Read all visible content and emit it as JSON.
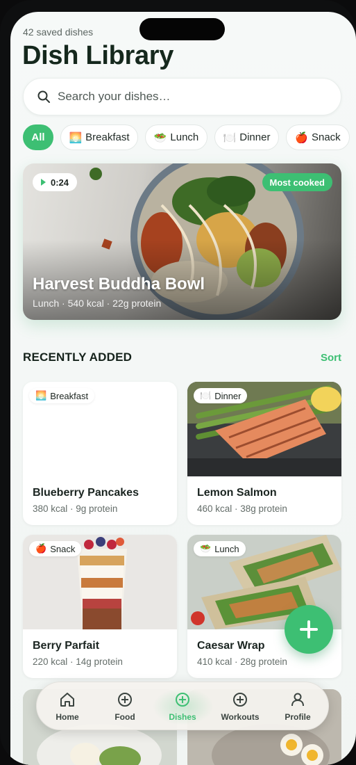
{
  "header": {
    "subtitle": "42 saved dishes",
    "title": "Dish Library"
  },
  "search": {
    "placeholder": "Search your dishes…",
    "icon": "search-icon"
  },
  "filters": [
    {
      "label": "All",
      "emoji": "",
      "active": true
    },
    {
      "label": "Breakfast",
      "emoji": "🌅",
      "active": false
    },
    {
      "label": "Lunch",
      "emoji": "🥗",
      "active": false
    },
    {
      "label": "Dinner",
      "emoji": "🍽️",
      "active": false
    },
    {
      "label": "Snack",
      "emoji": "🍎",
      "active": false
    }
  ],
  "featured": {
    "duration": "0:24",
    "badge": "Most cooked",
    "name": "Harvest Buddha Bowl",
    "meta": "Lunch · 540 kcal · 22g protein"
  },
  "recent": {
    "title": "RECENTLY ADDED",
    "sort_label": "Sort",
    "dishes": [
      {
        "tag": "Breakfast",
        "tag_emoji": "🌅",
        "name": "Blueberry Pancakes",
        "meta": "380 kcal · 9g protein"
      },
      {
        "tag": "Dinner",
        "tag_emoji": "🍽️",
        "name": "Lemon Salmon",
        "meta": "460 kcal · 38g protein"
      },
      {
        "tag": "Snack",
        "tag_emoji": "🍎",
        "name": "Berry Parfait",
        "meta": "220 kcal · 14g protein"
      },
      {
        "tag": "Lunch",
        "tag_emoji": "🥗",
        "name": "Caesar Wrap",
        "meta": "410 kcal · 28g protein"
      }
    ]
  },
  "fab": {
    "icon": "plus-icon"
  },
  "nav": {
    "items": [
      {
        "label": "Home",
        "icon": "home-icon",
        "active": false
      },
      {
        "label": "Food",
        "icon": "plus-circle-icon",
        "active": false
      },
      {
        "label": "Dishes",
        "icon": "plus-circle-icon",
        "active": true
      },
      {
        "label": "Workouts",
        "icon": "plus-circle-icon",
        "active": false
      },
      {
        "label": "Profile",
        "icon": "person-icon",
        "active": false
      }
    ]
  },
  "colors": {
    "accent": "#3dbf73",
    "background": "#f3f7f5",
    "text": "#15281d"
  }
}
